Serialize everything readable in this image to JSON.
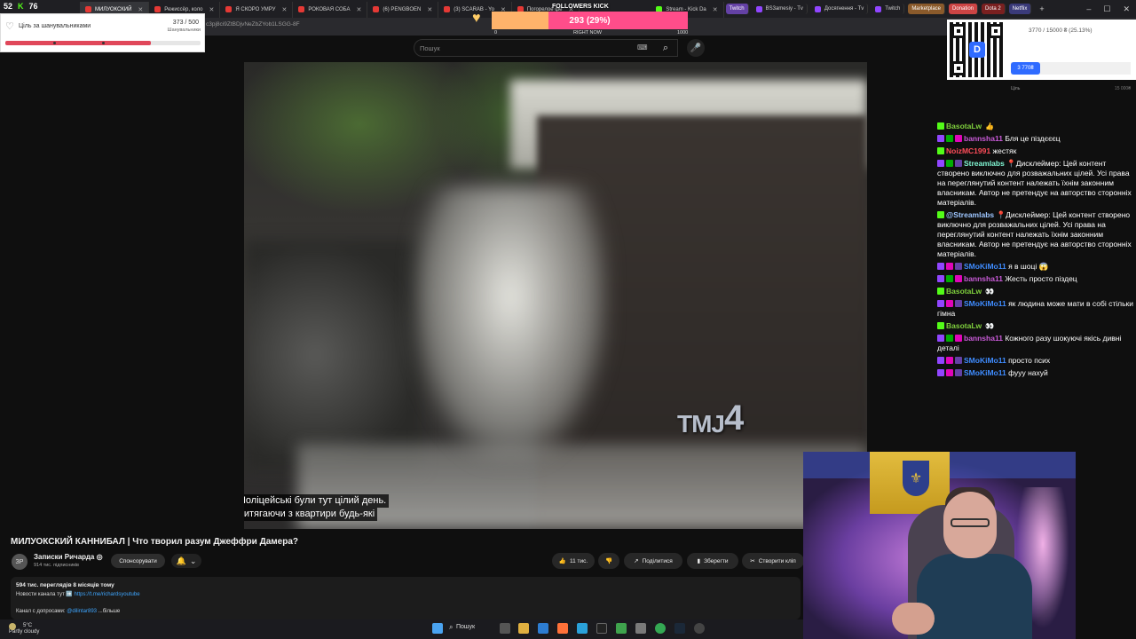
{
  "counters": {
    "left_value": "52",
    "right_value": "76"
  },
  "tabs": [
    {
      "label": "МИЛУОКСКИЙ",
      "active": true
    },
    {
      "label": "Режиссёр, коло"
    },
    {
      "label": "Я СКОРО УМРУ"
    },
    {
      "label": "РОКОВАЯ СОБА"
    },
    {
      "label": "(6) PENGBOEN"
    },
    {
      "label": "(3) SCARAB - Yo"
    },
    {
      "label": "Погорелое фе"
    },
    {
      "label": "Stream - Kick Da"
    },
    {
      "label": "Stream - Kick Di"
    }
  ],
  "bookmarks": [
    {
      "label": "Twitch",
      "color": "#6441a5"
    },
    {
      "label": "BS3amesiy - Tv"
    },
    {
      "label": "Досягнення - Tv"
    },
    {
      "label": "Twitch"
    },
    {
      "label": "Marketplace",
      "color": "#8a5a2b"
    },
    {
      "label": "Donation",
      "color": "#c44"
    },
    {
      "label": "Dota 2",
      "color": "#7a2020"
    },
    {
      "label": "Netflix",
      "color": "#3a3a7a"
    }
  ],
  "address": {
    "url": "c3pj8ci9ZtBDjvNeZbZYob1LSGG-8F"
  },
  "goal_widget": {
    "label": "Ціль за шанувальниками",
    "count": "373 / 500",
    "sub": "Шанувальники",
    "progress": 0.746
  },
  "followers_kick": {
    "title": "FOLLOWERS KICK",
    "value": "293 (29%)",
    "progress": 0.29,
    "min": "0",
    "mid": "RIGHT NOW",
    "max": "1000"
  },
  "donation": {
    "progress_text": "3770 / 15000 ₴ (25.13%)",
    "pill": "3 770₴",
    "min_label": "Ціль",
    "max_label": "15 000₴",
    "qr_logo": "D"
  },
  "search": {
    "placeholder": "Пошук"
  },
  "video": {
    "overlay_logo": "TMJ",
    "overlay_logo_num": "4",
    "caption_line1": "Поліцейські були тут цілий день.",
    "caption_line2": "витягаючи з квартири будь-які"
  },
  "under_video": {
    "title": "МИЛУОКСКИЙ КАННИБАЛ | Что творил разум Джеффри Дамера?",
    "channel": "Записки Ричарда ◎",
    "subscribers": "914 тис. підписників",
    "avatar_initials": "ЗР",
    "sponsor_label": "Спонсорувати",
    "likes": "11 тис.",
    "share_label": "Поділитися",
    "save_label": "Зберегти",
    "clip_label": "Створити кліп",
    "views": "594 тис. переглядів  8 місяців тому",
    "desc_text": "Новости канала тут ➡️ ",
    "desc_link": "https://t.me/richardsyoutube",
    "desc_line2": "Канал с допросами: ",
    "desc_line2_link": "@dilintar893",
    "desc_more": "...більше"
  },
  "chat": [
    {
      "platform": "kick",
      "user": "BasotaLw",
      "color": "#7fd03d",
      "text": "",
      "emote": "👍"
    },
    {
      "platform": "twitch",
      "badges": [
        "mod",
        "vip"
      ],
      "user": "bannsha11",
      "color": "#c95bd8",
      "text": "Бля це піздєєєц"
    },
    {
      "platform": "kick",
      "user": "NoizMC1991",
      "color": "#ff4d5a",
      "text": "жестяк"
    },
    {
      "platform": "twitch",
      "badges": [
        "mod",
        "verified"
      ],
      "user": "Streamlabs",
      "color": "#80f5d2",
      "text": "📍Дисклеймер: Цей контент створено виключно для розважальних цілей. Усі права на переглянутий контент належать їхнім законним власникам. Автор не претендує на авторство сторонніх матеріалів."
    },
    {
      "platform": "kick",
      "user": "@Streamlabs",
      "color": "#9ec6ff",
      "text": "📍Дисклеймер: Цей контент створено виключно для розважальних цілей. Усі права на переглянутий контент належать їхнім законним власникам. Автор не претендує на авторство сторонніх матеріалів."
    },
    {
      "platform": "twitch",
      "badges": [
        "vip",
        "sub"
      ],
      "user": "SMoKiMo11",
      "color": "#3f8cff",
      "text": "я в шоці 😱"
    },
    {
      "platform": "twitch",
      "badges": [
        "mod",
        "vip"
      ],
      "user": "bannsha11",
      "color": "#c95bd8",
      "text": "Жесть просто піздец"
    },
    {
      "platform": "kick",
      "user": "BasotaLw",
      "color": "#7fd03d",
      "text": "",
      "emote": "👀"
    },
    {
      "platform": "twitch",
      "badges": [
        "vip",
        "sub"
      ],
      "user": "SMoKiMo11",
      "color": "#3f8cff",
      "text": "як людина може мати в собі стільки гімна"
    },
    {
      "platform": "kick",
      "user": "BasotaLw",
      "color": "#7fd03d",
      "text": "",
      "emote": "👀"
    },
    {
      "platform": "twitch",
      "badges": [
        "mod",
        "vip"
      ],
      "user": "bannsha11",
      "color": "#c95bd8",
      "text": "Кожного разу шокуючі якісь дивні деталі"
    },
    {
      "platform": "twitch",
      "badges": [
        "vip",
        "sub"
      ],
      "user": "SMoKiMo11",
      "color": "#3f8cff",
      "text": "просто псих"
    },
    {
      "platform": "twitch",
      "badges": [
        "vip",
        "sub"
      ],
      "user": "SMoKiMo11",
      "color": "#3f8cff",
      "text": "фууу нахуй"
    }
  ],
  "taskbar": {
    "temp": "5°C",
    "weather": "Partly cloudy",
    "search_label": "Пошук"
  }
}
